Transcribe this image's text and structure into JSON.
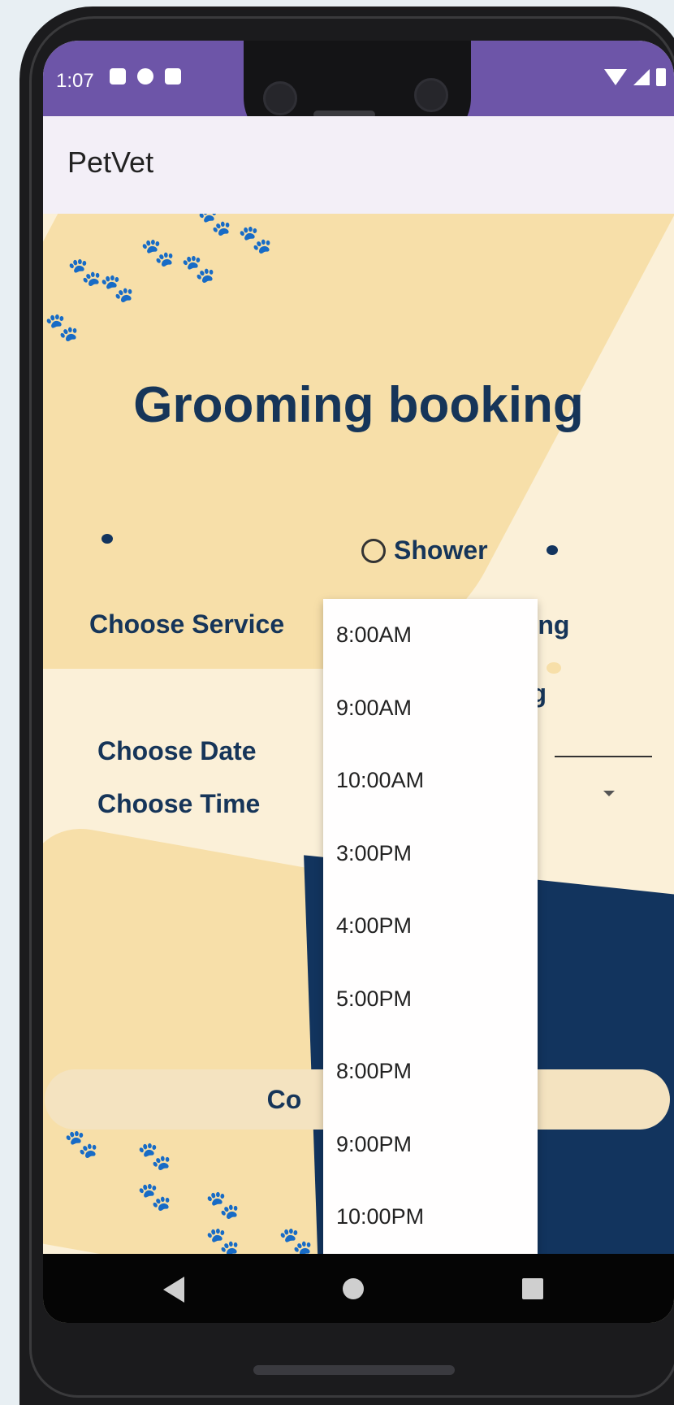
{
  "status_bar": {
    "time": "1:07"
  },
  "app_bar": {
    "title": "PetVet"
  },
  "form": {
    "title": "Grooming booking",
    "service_label": "Choose Service",
    "service_options": [
      {
        "label": "Shower",
        "selected": false
      },
      {
        "label": "ming"
      },
      {
        "label": "ing"
      }
    ],
    "date_label": "Choose Date",
    "time_label": "Choose Time",
    "confirm_button_visible_text": "Co"
  },
  "time_dropdown": {
    "options": [
      "8:00AM",
      "9:00AM",
      "10:00AM",
      "3:00PM",
      "4:00PM",
      "5:00PM",
      "8:00PM",
      "9:00PM",
      "10:00PM"
    ]
  },
  "colors": {
    "status_bar": "#6d55a8",
    "app_bar": "#f3eff7",
    "title_text": "#163559",
    "paw": "#5c9a3e",
    "background_light": "#fbf0d8",
    "background_dark": "#f7dfa9",
    "navy": "#12345e"
  },
  "nav_icons": [
    "back-icon",
    "home-icon",
    "recents-icon"
  ]
}
